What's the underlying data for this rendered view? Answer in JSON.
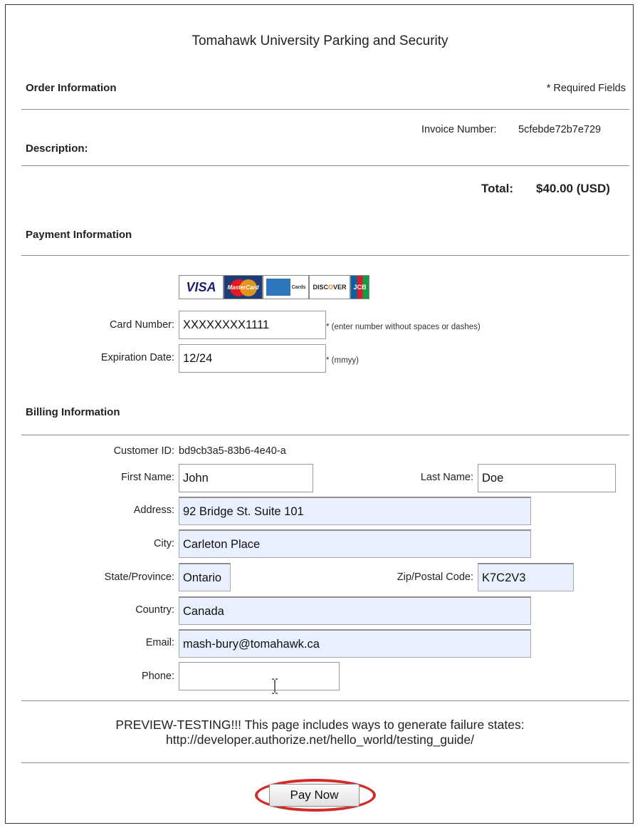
{
  "header": {
    "title": "Tomahawk University Parking and Security"
  },
  "order": {
    "section_label": "Order Information",
    "required_note": "* Required Fields",
    "invoice_label": "Invoice Number:",
    "invoice_value": "5cfebde72b7e729",
    "description_label": "Description:",
    "total_label": "Total:",
    "total_value": "$40.00 (USD)"
  },
  "payment": {
    "section_label": "Payment Information",
    "card_logos": [
      "VISA",
      "MasterCard",
      "American Express",
      "DISCOVER",
      "JCB"
    ],
    "card_number_label": "Card Number:",
    "card_number_value": "XXXXXXXX1111",
    "card_number_hint": "* (enter number without spaces or dashes)",
    "expiration_label": "Expiration Date:",
    "expiration_value": "12/24",
    "expiration_hint": "* (mmyy)"
  },
  "billing": {
    "section_label": "Billing Information",
    "customer_id_label": "Customer ID:",
    "customer_id_value": "bd9cb3a5-83b6-4e40-a",
    "first_name_label": "First Name:",
    "first_name_value": "John",
    "last_name_label": "Last Name:",
    "last_name_value": "Doe",
    "address_label": "Address:",
    "address_value": "92 Bridge St. Suite 101",
    "city_label": "City:",
    "city_value": "Carleton Place",
    "state_label": "State/Province:",
    "state_value": "Ontario",
    "zip_label": "Zip/Postal Code:",
    "zip_value": "K7C2V3",
    "country_label": "Country:",
    "country_value": "Canada",
    "email_label": "Email:",
    "email_value": "mash-bury@tomahawk.ca",
    "phone_label": "Phone:",
    "phone_value": ""
  },
  "notice": {
    "line1": "PREVIEW-TESTING!!! This page includes ways to generate failure states:",
    "line2": "http://developer.authorize.net/hello_world/testing_guide/"
  },
  "actions": {
    "pay_label": "Pay Now"
  },
  "colors": {
    "autofill_bg": "#e8f0fe",
    "highlight_ring": "#d32a2a"
  }
}
